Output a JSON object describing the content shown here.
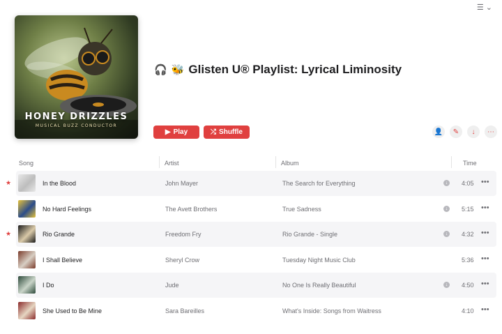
{
  "playlist": {
    "title": "Glisten U® Playlist: Lyrical Liminosity",
    "title_icons": [
      "🎧",
      "🐝"
    ],
    "artwork": {
      "title": "HONEY DRIZZLES",
      "subtitle": "MUSICAL BUZZ CONDUCTOR"
    }
  },
  "actions": {
    "play_label": "Play",
    "shuffle_label": "Shuffle",
    "icons": [
      "add-collaborator-icon",
      "edit-icon",
      "download-icon",
      "more-icon"
    ]
  },
  "table": {
    "headers": {
      "song": "Song",
      "artist": "Artist",
      "album": "Album",
      "time": "Time"
    },
    "rows": [
      {
        "song": "In the Blood",
        "artist": "John Mayer",
        "album": "The Search for Everything",
        "time": "4:05",
        "favorite": true,
        "download": true,
        "thumb_colors": [
          "#e8e8e8",
          "#bdbdbd"
        ]
      },
      {
        "song": "No Hard Feelings",
        "artist": "The Avett Brothers",
        "album": "True Sadness",
        "time": "5:15",
        "favorite": false,
        "download": true,
        "thumb_colors": [
          "#e6c23a",
          "#2b4c8a"
        ]
      },
      {
        "song": "Rio Grande",
        "artist": "Freedom Fry",
        "album": "Rio Grande - Single",
        "time": "4:32",
        "favorite": true,
        "download": true,
        "thumb_colors": [
          "#1a1a1a",
          "#d9c9a8"
        ]
      },
      {
        "song": "I Shall Believe",
        "artist": "Sheryl Crow",
        "album": "Tuesday Night Music Club",
        "time": "5:36",
        "favorite": false,
        "download": false,
        "thumb_colors": [
          "#7a3b2a",
          "#d8cfc4"
        ]
      },
      {
        "song": "I Do",
        "artist": "Jude",
        "album": "No One Is Really Beautiful",
        "time": "4:50",
        "favorite": false,
        "download": true,
        "thumb_colors": [
          "#2d4a3a",
          "#c9d4c8"
        ]
      },
      {
        "song": "She Used to Be Mine",
        "artist": "Sara Bareilles",
        "album": "What's Inside: Songs from Waitress",
        "time": "4:10",
        "favorite": false,
        "download": false,
        "thumb_colors": [
          "#8a2a2a",
          "#e6d6c2"
        ]
      }
    ]
  },
  "colors": {
    "accent": "#e0403f",
    "row_alt": "#f5f5f7",
    "secondary_text": "#6e6e73"
  }
}
